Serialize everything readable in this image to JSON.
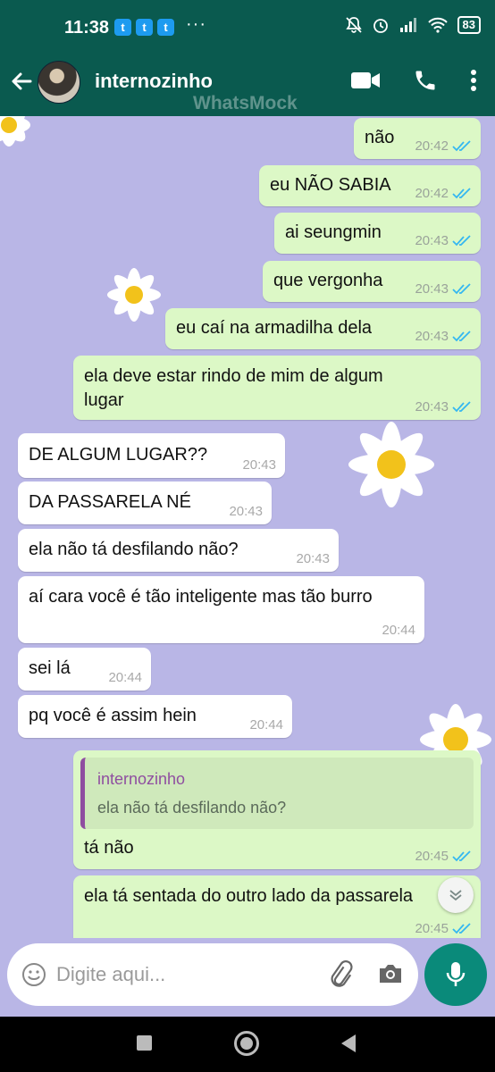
{
  "status_bar": {
    "time": "11:38",
    "twitter_icons": [
      "twitter-icon",
      "twitter-icon",
      "twitter-icon"
    ],
    "more": "···",
    "battery": "83"
  },
  "header": {
    "contact_name": "internozinho",
    "watermark": "WhatsMock"
  },
  "messages": [
    {
      "dir": "out",
      "text": "não",
      "time": "20:42",
      "read": true
    },
    {
      "dir": "out",
      "text": "eu NÃO SABIA",
      "time": "20:42",
      "read": true
    },
    {
      "dir": "out",
      "text": "ai seungmin",
      "time": "20:43",
      "read": true
    },
    {
      "dir": "out",
      "text": "que vergonha",
      "time": "20:43",
      "read": true
    },
    {
      "dir": "out",
      "text": "eu caí na armadilha dela",
      "time": "20:43",
      "read": true
    },
    {
      "dir": "out",
      "text_line1": "ela deve estar rindo de mim de algum",
      "text_line2": "lugar",
      "time": "20:43",
      "read": true
    },
    {
      "dir": "in",
      "text": "DE ALGUM LUGAR??",
      "time": "20:43"
    },
    {
      "dir": "in",
      "text": "DA PASSARELA NÉ",
      "time": "20:43"
    },
    {
      "dir": "in",
      "text": "ela não tá desfilando não?",
      "time": "20:43"
    },
    {
      "dir": "in",
      "text": "aí cara você é tão inteligente mas tão burro",
      "time": "20:44"
    },
    {
      "dir": "in",
      "text": "sei lá",
      "time": "20:44"
    },
    {
      "dir": "in",
      "text": "pq você é assim hein",
      "time": "20:44"
    },
    {
      "dir": "out",
      "quote_name": "internozinho",
      "quote_text": "ela não tá desfilando não?",
      "text": "tá não",
      "time": "20:45",
      "read": true
    },
    {
      "dir": "out",
      "text": "ela tá sentada do outro lado da passarela",
      "time": "20:45",
      "read": true
    }
  ],
  "input": {
    "placeholder": "Digite aqui..."
  },
  "colors": {
    "header": "#0a5a4f",
    "outgoing": "#dcf8c6",
    "incoming": "#ffffff",
    "wallpaper": "#b9b6e6",
    "mic": "#0a8a7a",
    "read_ticks": "#34b7f1"
  }
}
